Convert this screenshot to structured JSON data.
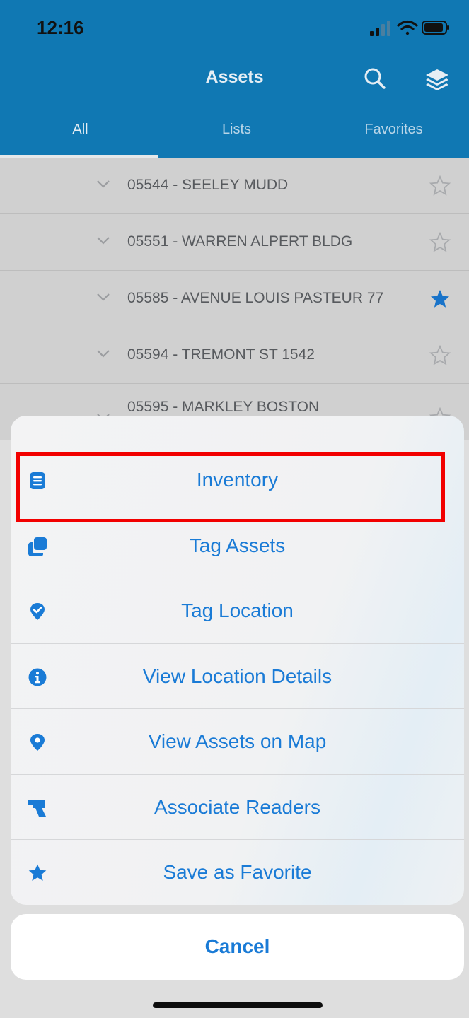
{
  "status_bar": {
    "time": "12:16"
  },
  "header": {
    "title": "Assets",
    "tabs": [
      {
        "label": "All",
        "active": true
      },
      {
        "label": "Lists",
        "active": false
      },
      {
        "label": "Favorites",
        "active": false
      }
    ]
  },
  "list": {
    "rows": [
      {
        "text": "05544  -  SEELEY MUDD",
        "favorite": false
      },
      {
        "text": "05551  -  WARREN ALPERT BLDG",
        "favorite": false
      },
      {
        "text": "05585  -  AVENUE LOUIS PASTEUR 77",
        "favorite": true
      },
      {
        "text": "05594  - TREMONT ST 1542",
        "favorite": false
      },
      {
        "text": "05595  -  MARKLEY BOSTON",
        "favorite": false
      }
    ]
  },
  "action_sheet": {
    "items": [
      {
        "label": "Inventory",
        "icon": "list-icon"
      },
      {
        "label": "Tag Assets",
        "icon": "copy-icon"
      },
      {
        "label": "Tag Location",
        "icon": "location-check-icon"
      },
      {
        "label": "View Location Details",
        "icon": "info-icon"
      },
      {
        "label": "View Assets on Map",
        "icon": "map-pin-icon"
      },
      {
        "label": "Associate Readers",
        "icon": "reader-icon"
      },
      {
        "label": "Save as Favorite",
        "icon": "star-icon"
      }
    ],
    "cancel_label": "Cancel"
  },
  "colors": {
    "header_bg": "#1078b3",
    "action_blue": "#1a7bd6",
    "highlight": "#f20000",
    "favorite_star": "#1a7bd6"
  }
}
